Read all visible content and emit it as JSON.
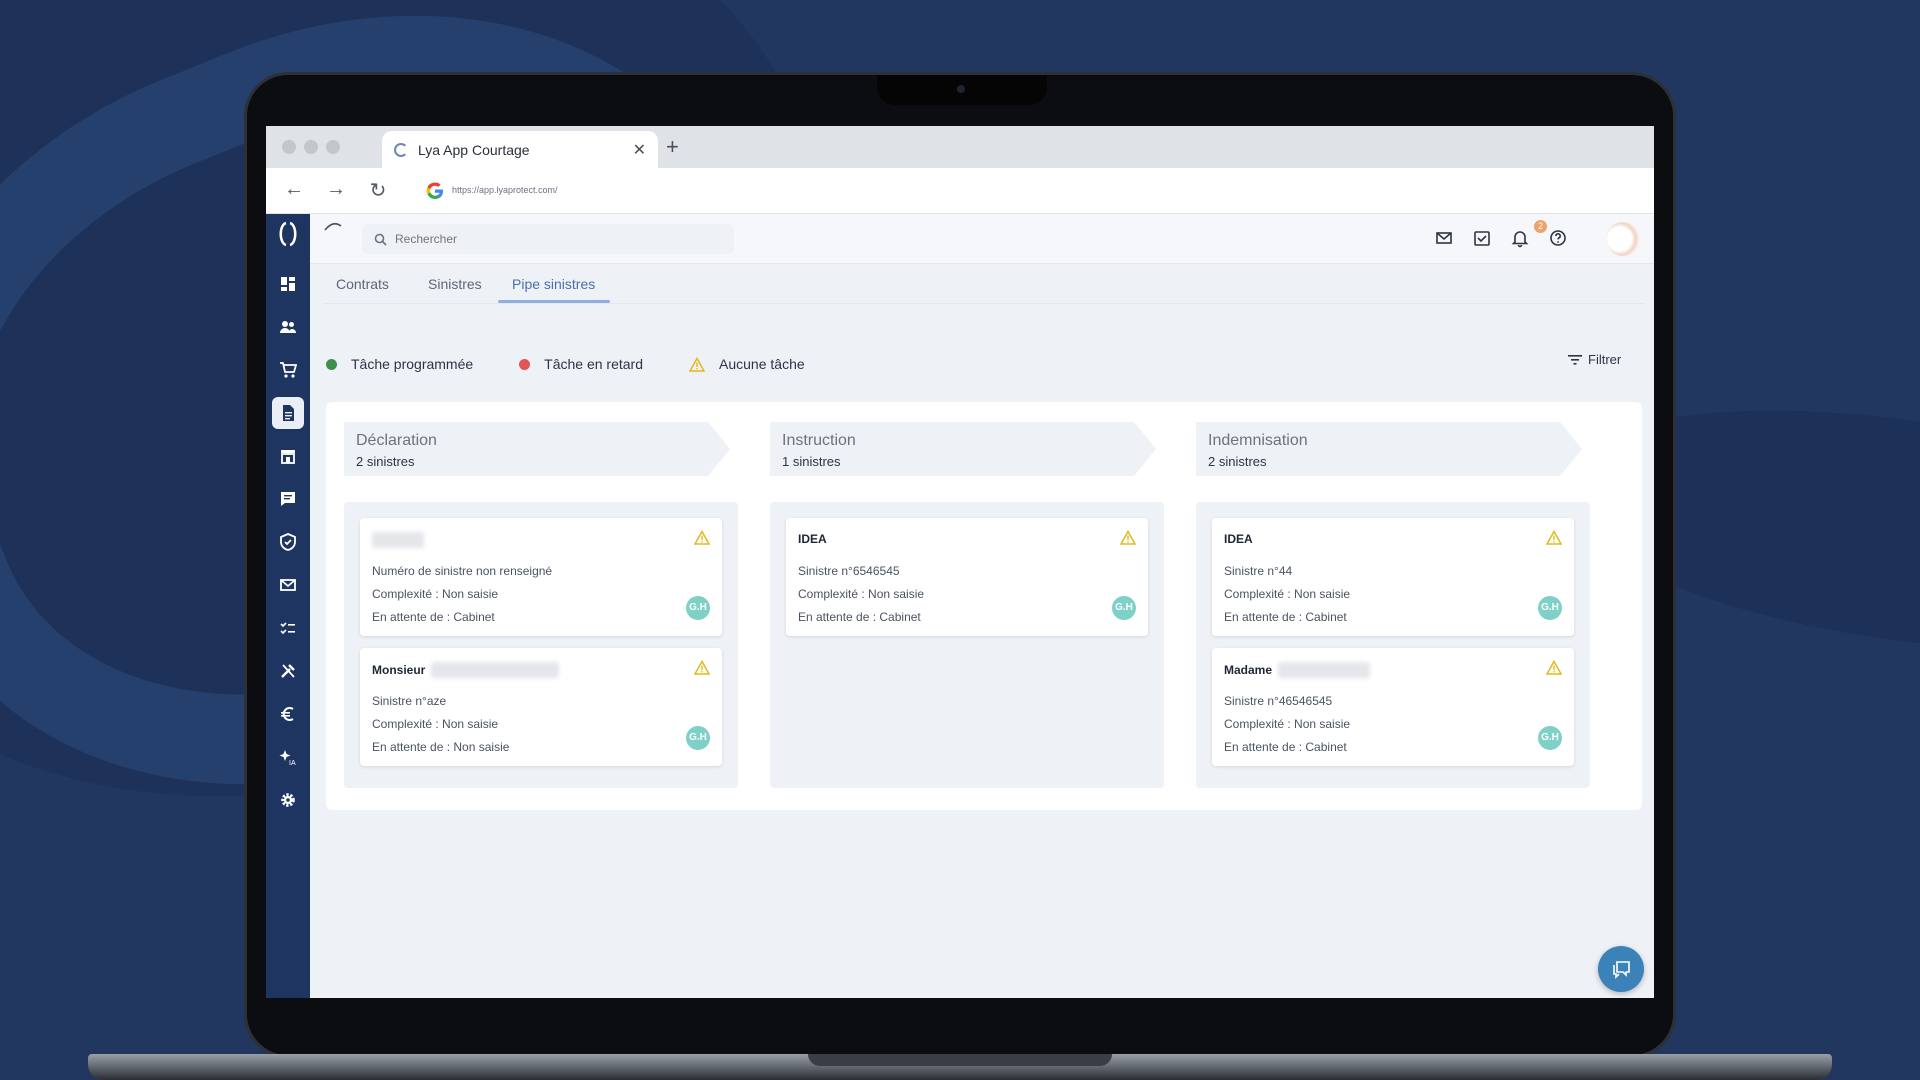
{
  "browser": {
    "tab_title": "Lya App Courtage",
    "tab_close": "✕",
    "new_tab": "+",
    "url": "https://app.lyaprotect.com/",
    "nav_back": "←",
    "nav_forward": "→",
    "nav_reload": "↻"
  },
  "topbar": {
    "search_placeholder": "Rechercher",
    "tasks_badge": "2"
  },
  "subtabs": [
    {
      "label": "Contrats",
      "active": false
    },
    {
      "label": "Sinistres",
      "active": false
    },
    {
      "label": "Pipe sinistres",
      "active": true
    }
  ],
  "legend": {
    "scheduled": "Tâche programmée",
    "late": "Tâche en retard",
    "none": "Aucune tâche",
    "filter": "Filtrer"
  },
  "colors": {
    "sidebar": "#1e3561",
    "scheduled": "#3f8f4f",
    "late": "#e05656",
    "warning": "#e3b81c",
    "avatar": "#7fd1c8",
    "accent": "#4a6fae",
    "chat": "#3b82b8"
  },
  "sidebar_icons": [
    "dashboard-icon",
    "users-icon",
    "cart-icon",
    "document-icon",
    "store-icon",
    "message-icon",
    "shield-icon",
    "mail-icon",
    "checklist-icon",
    "tools-icon",
    "euro-icon",
    "ai-sparkle-icon",
    "settings-icon"
  ],
  "columns": [
    {
      "title": "Déclaration",
      "count": "2 sinistres",
      "cards": [
        {
          "name": "",
          "redacted": true,
          "line1": "Numéro de sinistre non renseigné",
          "line2": "Complexité : Non saisie",
          "line3": "En attente de : Cabinet",
          "avatar": "G.H"
        },
        {
          "name": "Monsieur",
          "redacted": true,
          "line1": "Sinistre n°aze",
          "line2": "Complexité : Non saisie",
          "line3": "En attente de : Non saisie",
          "avatar": "G.H"
        }
      ]
    },
    {
      "title": "Instruction",
      "count": "1 sinistres",
      "cards": [
        {
          "name": "IDEA",
          "redacted": false,
          "line1": "Sinistre n°6546545",
          "line2": "Complexité : Non saisie",
          "line3": "En attente de : Cabinet",
          "avatar": "G.H"
        }
      ]
    },
    {
      "title": "Indemnisation",
      "count": "2 sinistres",
      "cards": [
        {
          "name": "IDEA",
          "redacted": false,
          "line1": "Sinistre n°44",
          "line2": "Complexité : Non saisie",
          "line3": "En attente de : Cabinet",
          "avatar": "G.H"
        },
        {
          "name": "Madame",
          "redacted": true,
          "line1": "Sinistre n°46546545",
          "line2": "Complexité : Non saisie",
          "line3": "En attente de : Cabinet",
          "avatar": "G.H"
        }
      ]
    }
  ]
}
